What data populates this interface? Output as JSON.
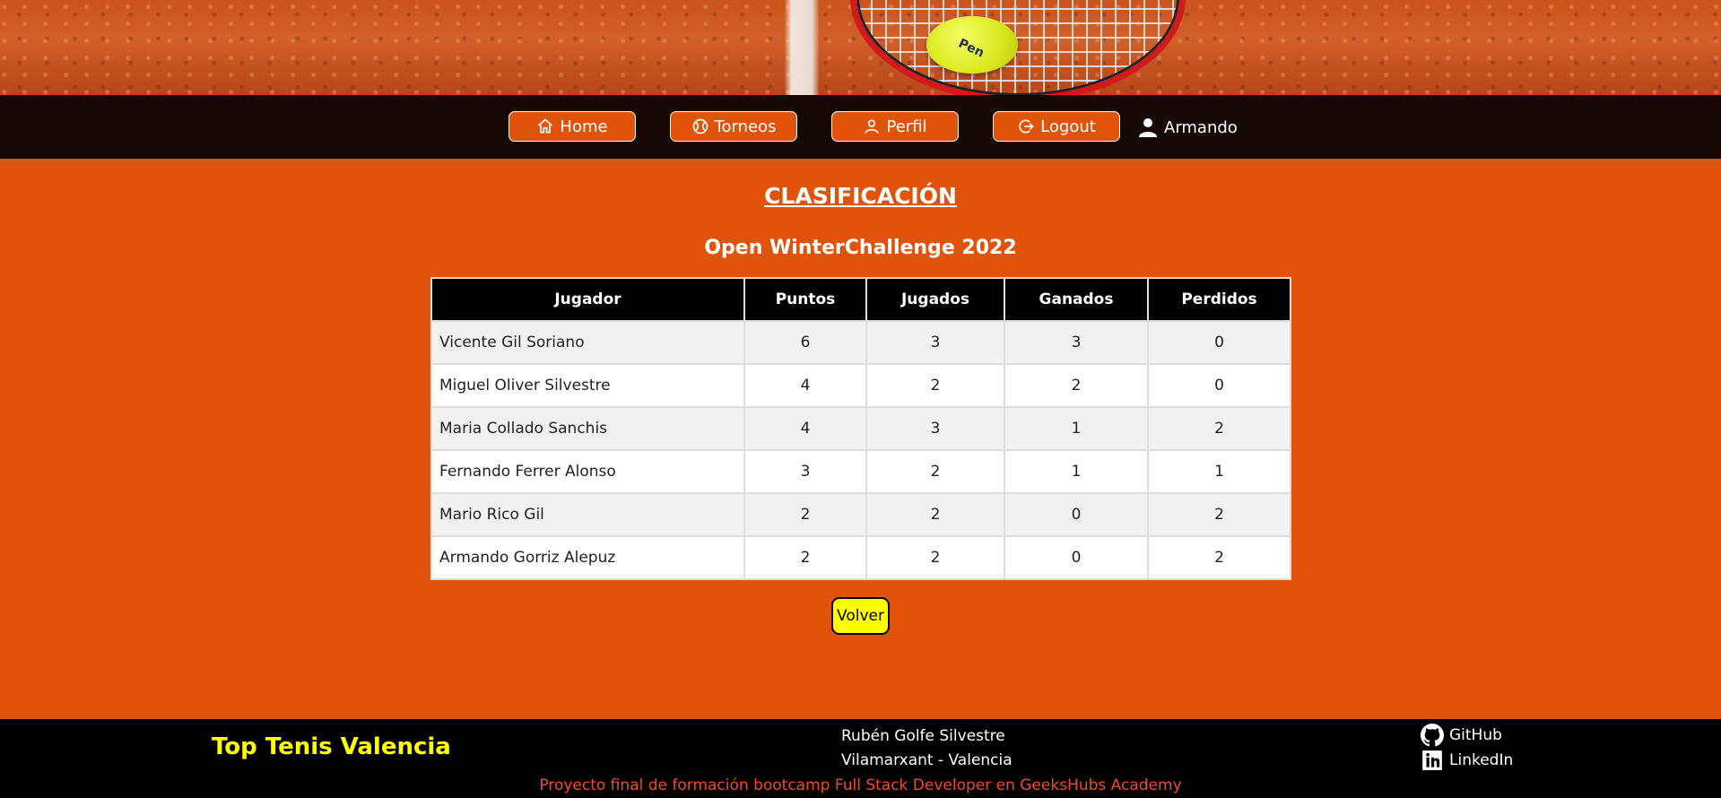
{
  "nav": {
    "home_label": "Home",
    "torneos_label": "Torneos",
    "perfil_label": "Perfil",
    "logout_label": "Logout",
    "username": "Armando"
  },
  "main": {
    "title": "CLASIFICACIÓN",
    "tournament": "Open WinterChallenge 2022",
    "columns": [
      "Jugador",
      "Puntos",
      "Jugados",
      "Ganados",
      "Perdidos"
    ],
    "rows": [
      [
        "Vicente Gil Soriano",
        "6",
        "3",
        "3",
        "0"
      ],
      [
        "Miguel Oliver Silvestre",
        "4",
        "2",
        "2",
        "0"
      ],
      [
        "Maria Collado Sanchis",
        "4",
        "3",
        "1",
        "2"
      ],
      [
        "Fernando Ferrer Alonso",
        "3",
        "2",
        "1",
        "1"
      ],
      [
        "Mario Rico Gil",
        "2",
        "2",
        "0",
        "2"
      ],
      [
        "Armando Gorriz Alepuz",
        "2",
        "2",
        "0",
        "2"
      ]
    ],
    "volver_label": "Volver"
  },
  "footer": {
    "brand": "Top Tenis Valencia",
    "author_name": "Rubén Golfe Silvestre",
    "author_location": "Vilamarxant - Valencia",
    "credit": "Proyecto final de formación bootcamp Full Stack Developer en GeeksHubs Academy",
    "github_label": "GitHub",
    "linkedin_label": "LinkedIn"
  },
  "banner": {
    "ball_text": "Pen"
  },
  "colors": {
    "accent": "#e0530a",
    "navbar": "#160803",
    "brand": "#ffff00",
    "credit": "#ef4b29"
  }
}
